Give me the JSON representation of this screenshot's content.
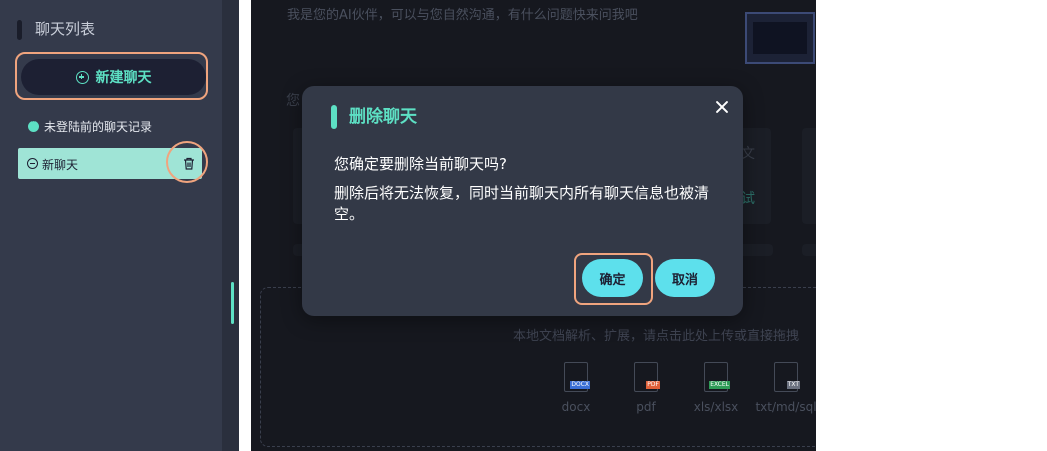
{
  "sidebar": {
    "title": "聊天列表",
    "new_chat_label": "新建聊天",
    "history_label": "未登陆前的聊天记录",
    "chats": [
      {
        "label": "新聊天"
      }
    ]
  },
  "main": {
    "intro": "我是您的AI伙伴，可以与您自然沟通，有什么问题快来问我吧",
    "fragment_left": "您",
    "fragment_card1": "文",
    "fragment_card2": "试",
    "upload_hint": "本地文档解析、扩展，请点击此处上传或直接拖拽",
    "file_types": [
      {
        "label": "docx",
        "tag": "DOCX",
        "tag_color": "#3b6fd6"
      },
      {
        "label": "pdf",
        "tag": "PDF",
        "tag_color": "#e0613a"
      },
      {
        "label": "xls/xlsx",
        "tag": "EXCEL",
        "tag_color": "#2f9b57"
      },
      {
        "label": "txt/md/sql",
        "tag": "TXT",
        "tag_color": "#6c7280"
      }
    ]
  },
  "modal": {
    "title": "删除聊天",
    "question": "您确定要删除当前聊天吗?",
    "description": "删除后将无法恢复，同时当前聊天内所有聊天信息也被清空。",
    "confirm_label": "确定",
    "cancel_label": "取消"
  },
  "colors": {
    "accent": "#5de0c4",
    "button": "#5de0ec",
    "highlight": "#f0a47e",
    "sidebar_bg": "#343a4b",
    "modal_bg": "#333947"
  }
}
